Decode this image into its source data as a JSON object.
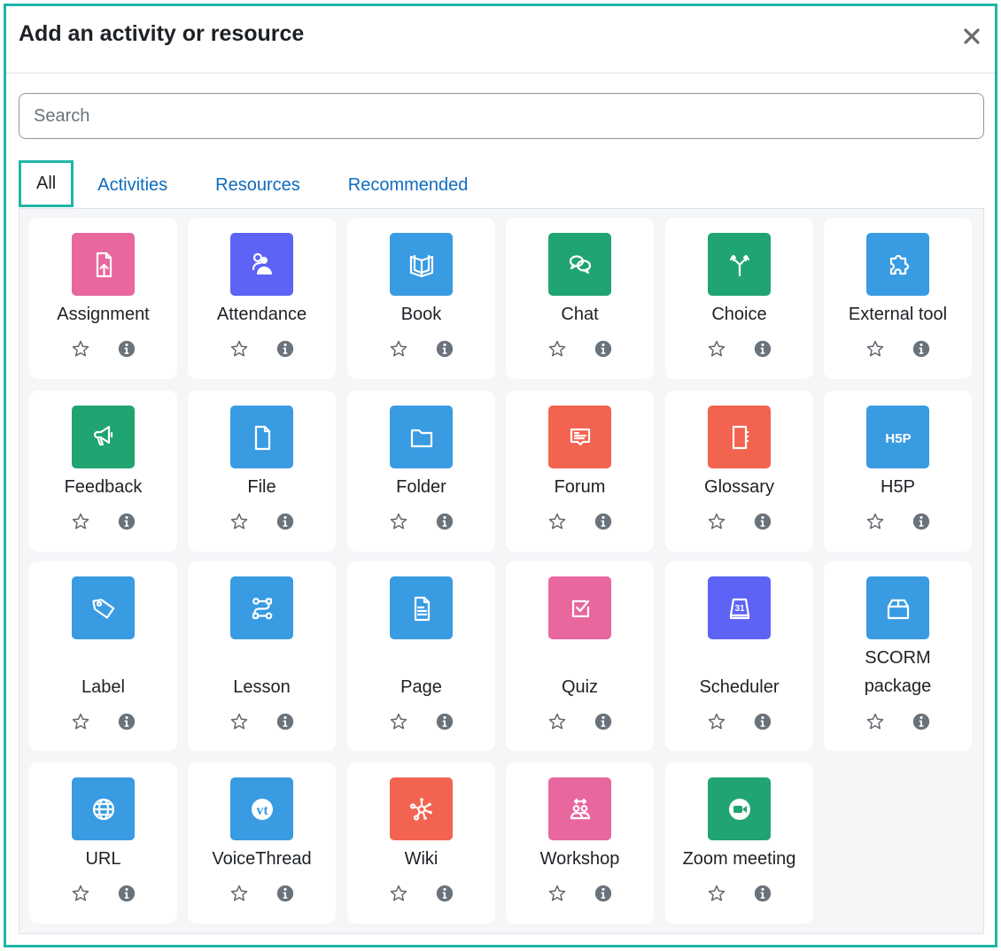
{
  "dialog": {
    "title": "Add an activity or resource",
    "close_icon": "close-icon"
  },
  "search": {
    "placeholder": "Search",
    "value": ""
  },
  "tabs": [
    {
      "label": "All",
      "active": true
    },
    {
      "label": "Activities",
      "active": false
    },
    {
      "label": "Resources",
      "active": false
    },
    {
      "label": "Recommended",
      "active": false
    }
  ],
  "colors": {
    "highlight": "#1fb5a8",
    "link": "#0f6cbf",
    "pink": "#e7679e",
    "purple": "#5d63f5",
    "blue": "#399be2",
    "green": "#1fa472",
    "red": "#f26350",
    "action_icon": "#6a737b"
  },
  "items": [
    {
      "name": "Assignment",
      "icon": "assignment-icon",
      "color": "#e7679e"
    },
    {
      "name": "Attendance",
      "icon": "attendance-icon",
      "color": "#5d63f5"
    },
    {
      "name": "Book",
      "icon": "book-icon",
      "color": "#399be2"
    },
    {
      "name": "Chat",
      "icon": "chat-icon",
      "color": "#1fa472"
    },
    {
      "name": "Choice",
      "icon": "choice-icon",
      "color": "#1fa472"
    },
    {
      "name": "External tool",
      "icon": "puzzle-icon",
      "color": "#399be2"
    },
    {
      "name": "Feedback",
      "icon": "megaphone-icon",
      "color": "#1fa472"
    },
    {
      "name": "File",
      "icon": "file-icon",
      "color": "#399be2"
    },
    {
      "name": "Folder",
      "icon": "folder-icon",
      "color": "#399be2"
    },
    {
      "name": "Forum",
      "icon": "forum-icon",
      "color": "#f26350"
    },
    {
      "name": "Glossary",
      "icon": "glossary-icon",
      "color": "#f26350"
    },
    {
      "name": "H5P",
      "icon": "h5p-icon",
      "color": "#399be2",
      "glyph_text": "H5P"
    },
    {
      "name": "Label",
      "icon": "tag-icon",
      "color": "#399be2"
    },
    {
      "name": "Lesson",
      "icon": "lesson-path-icon",
      "color": "#399be2"
    },
    {
      "name": "Page",
      "icon": "page-icon",
      "color": "#399be2"
    },
    {
      "name": "Quiz",
      "icon": "quiz-checkbox-icon",
      "color": "#e7679e"
    },
    {
      "name": "Scheduler",
      "icon": "calendar-icon",
      "color": "#5d63f5",
      "glyph_text": "31"
    },
    {
      "name": "SCORM package",
      "icon": "package-box-icon",
      "color": "#399be2"
    },
    {
      "name": "URL",
      "icon": "globe-icon",
      "color": "#399be2"
    },
    {
      "name": "VoiceThread",
      "icon": "voicethread-icon",
      "color": "#399be2",
      "glyph_text": "vt"
    },
    {
      "name": "Wiki",
      "icon": "wiki-network-icon",
      "color": "#f26350"
    },
    {
      "name": "Workshop",
      "icon": "workshop-icon",
      "color": "#e7679e"
    },
    {
      "name": "Zoom meeting",
      "icon": "video-camera-icon",
      "color": "#1fa472"
    }
  ],
  "item_actions": {
    "star_icon": "star-outline-icon",
    "info_icon": "info-circle-icon"
  }
}
